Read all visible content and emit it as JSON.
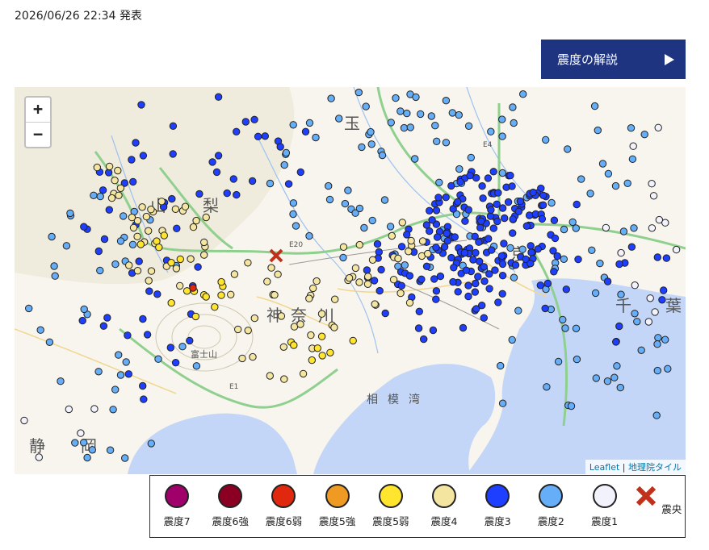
{
  "header": {
    "announce_time": "2026/06/26 22:34 発表",
    "explain_button_label": "震度の解説"
  },
  "map": {
    "zoom_in_label": "+",
    "zoom_out_label": "−",
    "attribution_leaflet": "Leaflet",
    "attribution_separator": " | ",
    "attribution_gsi": "地理院タイル",
    "place_labels": {
      "saitama": "玉",
      "yamanashi_1": "山",
      "yamanashi_2": "梨",
      "kanagawa_1": "神",
      "kanagawa_2": "奈",
      "kanagawa_3": "川",
      "tokyo": "京",
      "chiba_1": "千",
      "chiba_2": "葉",
      "shizuoka_1": "静",
      "shizuoka_2": "岡",
      "sagami_1": "相",
      "sagami_2": "模",
      "sagami_3": "湾",
      "mt_fuji": "富士山",
      "e20": "E20",
      "e4": "E4",
      "e1": "E1"
    },
    "epicenter": {
      "label": "震央"
    }
  },
  "colors": {
    "int7": "#a0006a",
    "int6u": "#8b0022",
    "int6l": "#e0280f",
    "int5u": "#ef9a22",
    "int5l": "#ffe52e",
    "int4": "#f4e6a0",
    "int3": "#1e3fff",
    "int2": "#66aef8",
    "int1": "#f2f2fc",
    "epicenter": "#c0301a"
  },
  "legend": [
    {
      "label": "震度7",
      "color": "#a0006a"
    },
    {
      "label": "震度6強",
      "color": "#8b0022"
    },
    {
      "label": "震度6弱",
      "color": "#e0280f"
    },
    {
      "label": "震度5強",
      "color": "#ef9a22"
    },
    {
      "label": "震度5弱",
      "color": "#ffe52e"
    },
    {
      "label": "震度4",
      "color": "#f4e6a0"
    },
    {
      "label": "震度3",
      "color": "#1e3fff"
    },
    {
      "label": "震度2",
      "color": "#66aef8"
    },
    {
      "label": "震度1",
      "color": "#f2f2fc"
    }
  ]
}
